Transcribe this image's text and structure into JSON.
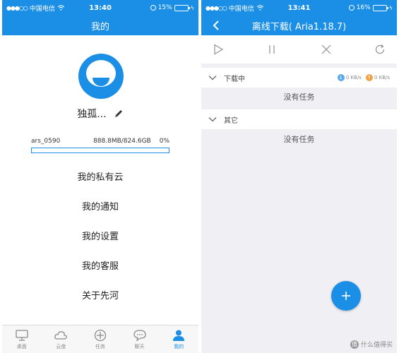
{
  "left": {
    "status": {
      "carrier": "中国电信",
      "time": "13:40",
      "battery": "15%",
      "battery_level": 0.15
    },
    "title": "我的",
    "profile": {
      "name": "独孤...",
      "account": "ars_0590",
      "storage": "888.8MB/824.6GB",
      "percent": "0%",
      "usage_fraction": 0.0
    },
    "menu": [
      {
        "label": "我的私有云"
      },
      {
        "label": "我的通知"
      },
      {
        "label": "我的设置"
      },
      {
        "label": "我的客服"
      },
      {
        "label": "关于先河"
      }
    ],
    "tabs": [
      {
        "label": "桌面",
        "icon": "desktop-icon"
      },
      {
        "label": "云盘",
        "icon": "cloud-icon"
      },
      {
        "label": "任务",
        "icon": "task-plus-icon"
      },
      {
        "label": "聊天",
        "icon": "chat-icon"
      },
      {
        "label": "我的",
        "icon": "person-icon"
      }
    ],
    "active_tab": "我的"
  },
  "right": {
    "status": {
      "carrier": "中国电信",
      "time": "13:41",
      "battery": "16%",
      "battery_level": 0.16
    },
    "title": "离线下载( Aria1.18.7)",
    "toolbar": [
      "play-icon",
      "pause-icon",
      "close-icon",
      "refresh-icon"
    ],
    "downloading": {
      "label": "下载中",
      "down_speed": "0 KB/s",
      "up_speed": "0 KB/s",
      "empty": "没有任务"
    },
    "other": {
      "label": "其它",
      "empty": "没有任务"
    },
    "watermark": "什么值得买"
  },
  "colors": {
    "accent": "#1b8ee6",
    "upload": "#f0a145",
    "download": "#5aa9ea"
  }
}
